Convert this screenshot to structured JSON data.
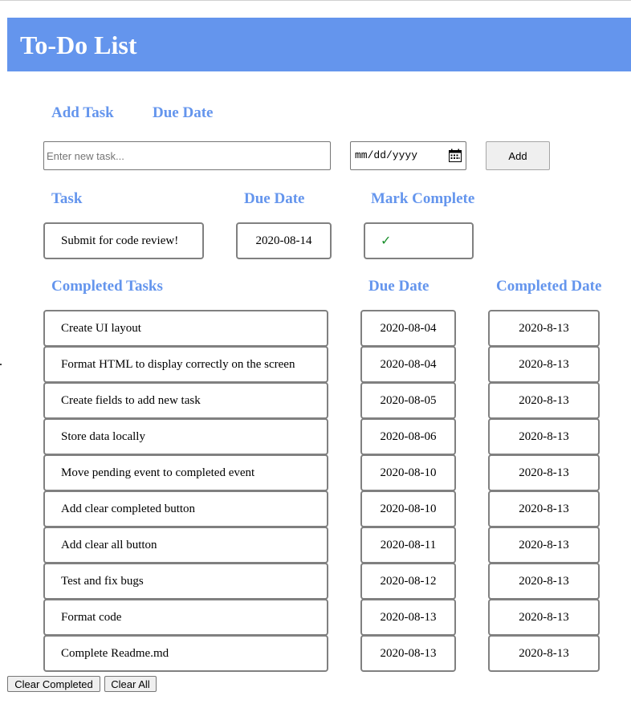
{
  "header": {
    "title": "To-Do List",
    "background_color": "#6495ed"
  },
  "add_form": {
    "add_task_label": "Add Task",
    "due_date_label": "Due Date",
    "task_input": {
      "placeholder": "Enter new task...",
      "value": ""
    },
    "date_input": {
      "display": "mm/dd/yyyy",
      "icon": "calendar-icon"
    },
    "add_button_label": "Add"
  },
  "pending": {
    "headers": {
      "task": "Task",
      "due_date": "Due Date",
      "mark_complete": "Mark Complete"
    },
    "items": [
      {
        "task": "Submit for code review!",
        "due_date": "2020-08-14",
        "mark": "✓"
      }
    ]
  },
  "completed": {
    "headers": {
      "task": "Completed Tasks",
      "due_date": "Due Date",
      "completed_date": "Completed Date"
    },
    "items": [
      {
        "task": "Create UI layout",
        "due_date": "2020-08-04",
        "completed_date": "2020-8-13"
      },
      {
        "task": "Format HTML to display correctly on the screen",
        "due_date": "2020-08-04",
        "completed_date": "2020-8-13"
      },
      {
        "task": "Create fields to add new task",
        "due_date": "2020-08-05",
        "completed_date": "2020-8-13"
      },
      {
        "task": "Store data locally",
        "due_date": "2020-08-06",
        "completed_date": "2020-8-13"
      },
      {
        "task": "Move pending event to completed event",
        "due_date": "2020-08-10",
        "completed_date": "2020-8-13"
      },
      {
        "task": "Add clear completed button",
        "due_date": "2020-08-10",
        "completed_date": "2020-8-13"
      },
      {
        "task": "Add clear all button",
        "due_date": "2020-08-11",
        "completed_date": "2020-8-13"
      },
      {
        "task": "Test and fix bugs",
        "due_date": "2020-08-12",
        "completed_date": "2020-8-13"
      },
      {
        "task": "Format code",
        "due_date": "2020-08-13",
        "completed_date": "2020-8-13"
      },
      {
        "task": "Complete Readme.md",
        "due_date": "2020-08-13",
        "completed_date": "2020-8-13"
      }
    ]
  },
  "footer": {
    "clear_completed_label": "Clear Completed",
    "clear_all_label": "Clear All"
  },
  "colors": {
    "accent": "#6495ed",
    "border": "#808080",
    "check": "#1a8f2c"
  }
}
